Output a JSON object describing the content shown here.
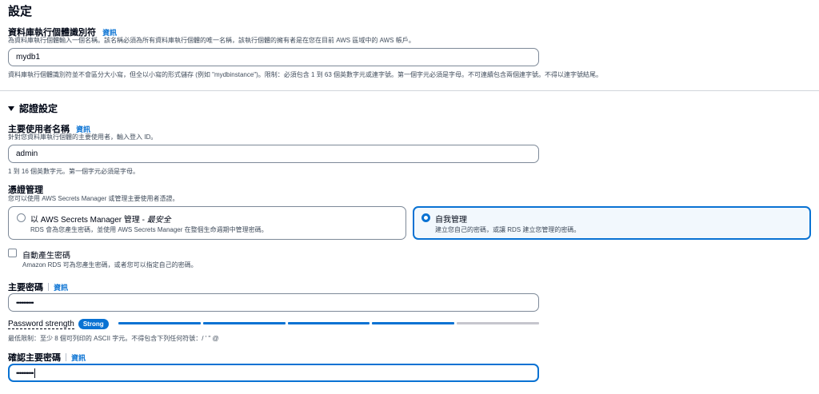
{
  "page": {
    "title": "設定"
  },
  "instance_identifier": {
    "label": "資料庫執行個體識別符",
    "info": "資訊",
    "description": "為資料庫執行個體輸入一個名稱。該名稱必須為所有資料庫執行個體的唯一名稱，該執行個體的擁有者是在您在目前 AWS 區域中的 AWS 帳戶。",
    "value": "mydb1",
    "constraint": "資料庫執行個體識別符並不會區分大小寫，但全以小寫的形式儲存 (例如 \"mydbinstance\")。限制：必須包含 1 到 63 個英數字元或連字號。第一個字元必須是字母。不可連續包含兩個連字號。不得以連字號結尾。"
  },
  "credentials_section": {
    "title": "認證設定",
    "master_username": {
      "label": "主要使用者名稱",
      "info": "資訊",
      "description": "針對您資料庫執行個體的主要使用者，輸入登入 ID。",
      "value": "admin",
      "constraint": "1 到 16 個英數字元。第一個字元必須是字母。"
    },
    "credentials_management": {
      "label": "憑證管理",
      "description": "您可以使用 AWS Secrets Manager 或管理主要使用者憑證。",
      "options": [
        {
          "title": "以 AWS Secrets Manager 管理 - ",
          "title_emphasis": "最安全",
          "description": "RDS 會為您產生密碼，並使用 AWS Secrets Manager 在整個生命週期中管理密碼。",
          "selected": false
        },
        {
          "title": "自我管理",
          "title_emphasis": "",
          "description": "建立您自己的密碼，或讓 RDS 建立您管理的密碼。",
          "selected": true
        }
      ]
    },
    "auto_generate": {
      "label": "自動產生密碼",
      "description": "Amazon RDS 可為您產生密碼，或者您可以指定自己的密碼。",
      "checked": false
    },
    "master_password": {
      "label": "主要密碼",
      "info": "資訊",
      "value": "••••••••••"
    },
    "password_strength": {
      "label": "Password strength",
      "badge": "Strong",
      "filled_segments": 4,
      "total_segments": 5,
      "fill_color": "#0972d3",
      "empty_color": "#c6c6cd"
    },
    "password_constraint": "最低限制：至少 8 個可列印的 ASCII 字元。不得包含下列任何符號：/ ' \" @",
    "confirm_password": {
      "label": "確認主要密碼",
      "info": "資訊",
      "value": "••••••••••"
    }
  }
}
